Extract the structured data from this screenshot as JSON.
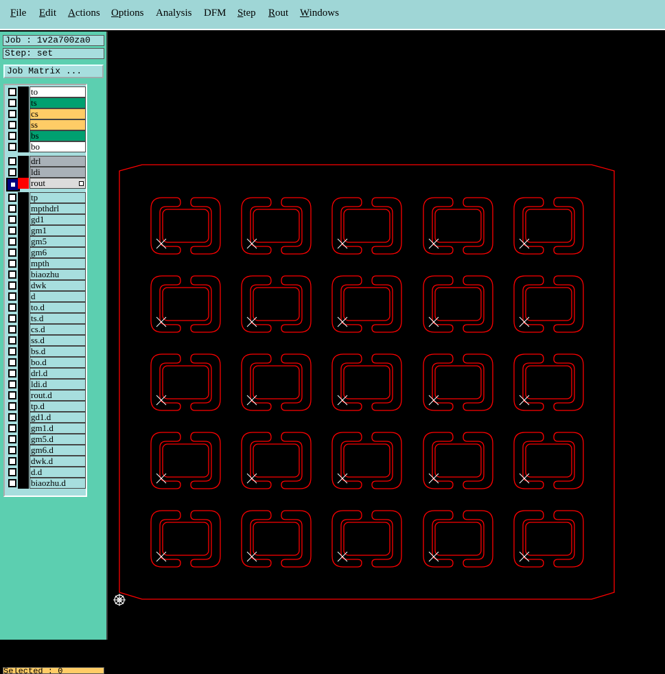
{
  "menu": {
    "items": [
      "File",
      "Edit",
      "Actions",
      "Options",
      "Analysis",
      "DFM",
      "Step",
      "Rout",
      "Windows"
    ]
  },
  "job": {
    "label": "Job : 1v2a700za0"
  },
  "step": {
    "label": "Step: set"
  },
  "job_matrix": {
    "label": "Job Matrix ..."
  },
  "layers": [
    {
      "name": "to",
      "color": "#ffffff"
    },
    {
      "name": "ts",
      "color": "#00a070"
    },
    {
      "name": "cs",
      "color": "#ffcc66"
    },
    {
      "name": "ss",
      "color": "#ffcc66"
    },
    {
      "name": "bs",
      "color": "#00a070"
    },
    {
      "name": "bo",
      "color": "#ffffff"
    },
    {
      "name": "drl",
      "color": "#a9b1b8"
    },
    {
      "name": "ldi",
      "color": "#a9b1b8"
    },
    {
      "name": "rout",
      "color": "#dcdcdc",
      "active": true,
      "swatch": "#ff0000"
    },
    {
      "name": "tp",
      "color": "#a7dede"
    },
    {
      "name": "mpthdrl",
      "color": "#a7dede"
    },
    {
      "name": "gd1",
      "color": "#a7dede"
    },
    {
      "name": "gm1",
      "color": "#a7dede"
    },
    {
      "name": "gm5",
      "color": "#a7dede"
    },
    {
      "name": "gm6",
      "color": "#a7dede"
    },
    {
      "name": "mpth",
      "color": "#a7dede"
    },
    {
      "name": "biaozhu",
      "color": "#a7dede"
    },
    {
      "name": "dwk",
      "color": "#a7dede"
    },
    {
      "name": "d",
      "color": "#a7dede"
    },
    {
      "name": "to.d",
      "color": "#a7dede"
    },
    {
      "name": "ts.d",
      "color": "#a7dede"
    },
    {
      "name": "cs.d",
      "color": "#a7dede"
    },
    {
      "name": "ss.d",
      "color": "#a7dede"
    },
    {
      "name": "bs.d",
      "color": "#a7dede"
    },
    {
      "name": "bo.d",
      "color": "#a7dede"
    },
    {
      "name": "drl.d",
      "color": "#a7dede"
    },
    {
      "name": "ldi.d",
      "color": "#a7dede"
    },
    {
      "name": "rout.d",
      "color": "#a7dede"
    },
    {
      "name": "tp.d",
      "color": "#a7dede"
    },
    {
      "name": "gd1.d",
      "color": "#a7dede"
    },
    {
      "name": "gm1.d",
      "color": "#a7dede"
    },
    {
      "name": "gm5.d",
      "color": "#a7dede"
    },
    {
      "name": "gm6.d",
      "color": "#a7dede"
    },
    {
      "name": "dwk.d",
      "color": "#a7dede"
    },
    {
      "name": "d.d",
      "color": "#a7dede"
    },
    {
      "name": "biaozhu.d",
      "color": "#a7dede"
    }
  ],
  "status": {
    "label": "Selected : 0"
  },
  "board": {
    "rows": 5,
    "cols": 5,
    "rout_color": "#ff0000",
    "marker_color": "#ffffff",
    "background": "#000000"
  }
}
